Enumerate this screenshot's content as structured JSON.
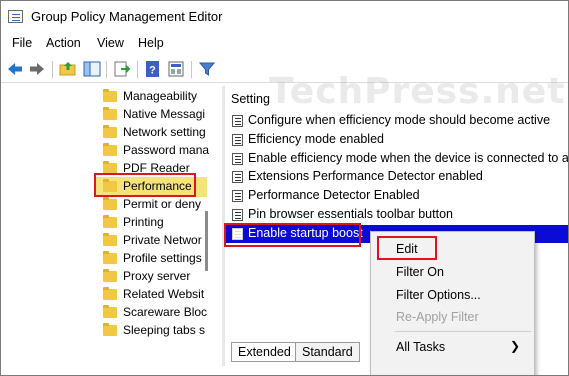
{
  "window": {
    "title": "Group Policy Management Editor"
  },
  "menubar": {
    "items": [
      "File",
      "Action",
      "View",
      "Help"
    ]
  },
  "toolbar": {
    "buttons": [
      "back-icon",
      "forward-icon",
      "up-folder-icon",
      "show-hide-tree-icon",
      "export-list-icon",
      "help-icon",
      "properties-icon",
      "filter-icon"
    ]
  },
  "tree": {
    "items": [
      {
        "label": "Manageability"
      },
      {
        "label": "Native Messagi"
      },
      {
        "label": "Network setting"
      },
      {
        "label": "Password mana"
      },
      {
        "label": "PDF Reader"
      },
      {
        "label": "Performance",
        "selected": true
      },
      {
        "label": "Permit or deny"
      },
      {
        "label": "Printing"
      },
      {
        "label": "Private Networ"
      },
      {
        "label": "Profile settings"
      },
      {
        "label": "Proxy server"
      },
      {
        "label": "Related Websit"
      },
      {
        "label": "Scareware Bloc"
      },
      {
        "label": "Sleeping tabs s"
      }
    ]
  },
  "settings": {
    "header": "Setting",
    "rows": [
      {
        "label": "Configure when efficiency mode should become active"
      },
      {
        "label": "Efficiency mode enabled"
      },
      {
        "label": "Enable efficiency mode when the device is connected to a p..."
      },
      {
        "label": "Extensions Performance Detector enabled"
      },
      {
        "label": "Performance Detector Enabled"
      },
      {
        "label": "Pin browser essentials toolbar button"
      },
      {
        "label": "Enable startup boost",
        "selected": true
      }
    ]
  },
  "tabs": [
    "Extended",
    "Standard"
  ],
  "context_menu": {
    "items": [
      {
        "label": "Edit",
        "enabled": true
      },
      {
        "label": "Filter On",
        "enabled": true
      },
      {
        "label": "Filter Options...",
        "enabled": true
      },
      {
        "label": "Re-Apply Filter",
        "enabled": false
      },
      {
        "label": "All Tasks",
        "enabled": true,
        "submenu": true
      }
    ]
  },
  "watermark": "TechPress.net",
  "colors": {
    "selection_blue": "#0b0bd6",
    "tree_selection": "#f6e27a",
    "highlight_border": "#e0141e"
  }
}
